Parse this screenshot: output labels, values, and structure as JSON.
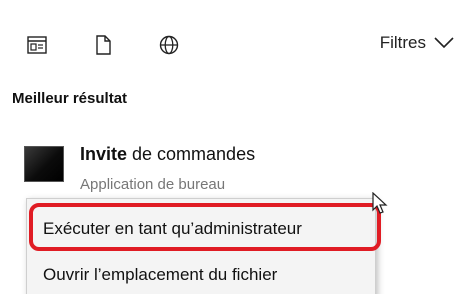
{
  "toolbar": {
    "filters_label": "Filtres"
  },
  "section": {
    "title": "Meilleur résultat"
  },
  "best_result": {
    "title_bold": "Invite",
    "title_rest": " de commandes",
    "subtitle": "Application de bureau"
  },
  "context_menu": {
    "items": [
      {
        "label": "Exécuter en tant qu’administrateur"
      },
      {
        "label": "Ouvrir l’emplacement du fichier"
      }
    ]
  },
  "colors": {
    "highlight": "#e01c24"
  },
  "icons": [
    "apps-filter-icon",
    "document-filter-icon",
    "web-filter-icon",
    "chevron-down-icon",
    "command-prompt-icon",
    "mouse-pointer-icon"
  ]
}
